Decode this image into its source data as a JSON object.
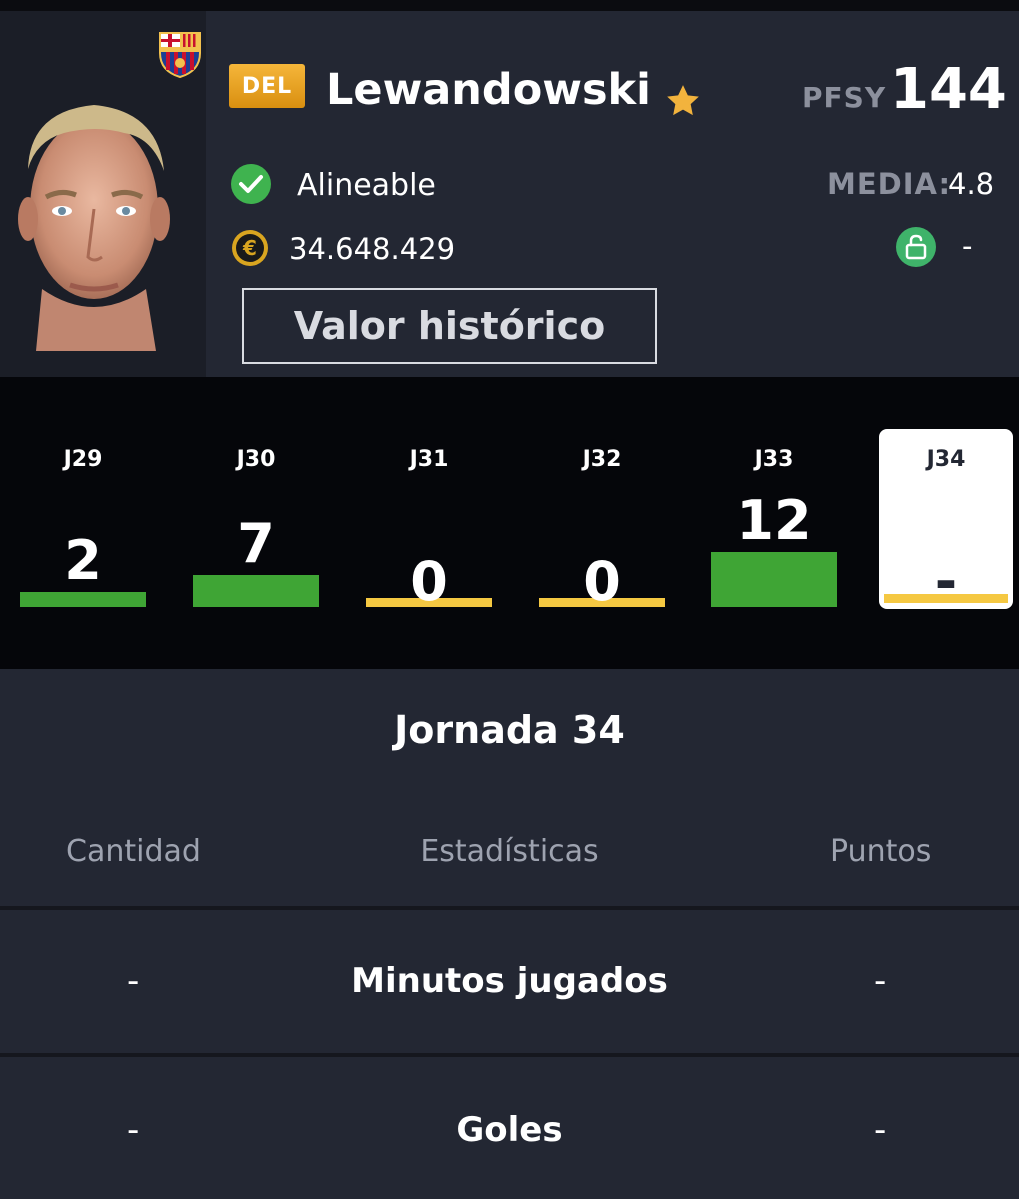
{
  "player": {
    "position": "DEL",
    "name": "Lewandowski",
    "pfsy_label": "PFSY",
    "pfsy_value": "144",
    "status": "Alineable",
    "media_label": "MEDIA:",
    "media_value": "4.8",
    "price": "34.648.429",
    "clause_value": "-",
    "history_button": "Valor histórico"
  },
  "colors": {
    "background": "#232733",
    "strip_background": "#05060a",
    "position_badge": "#f0a92b",
    "bar_positive": "#3fa535",
    "bar_zero": "#f5c842",
    "status_ok": "#3fb34f",
    "lock_green": "#3fb36a"
  },
  "matchdays": [
    {
      "label": "J29",
      "points": "2",
      "value": 2,
      "bar_color": "#3fa535",
      "selected": false
    },
    {
      "label": "J30",
      "points": "7",
      "value": 7,
      "bar_color": "#3fa535",
      "selected": false
    },
    {
      "label": "J31",
      "points": "0",
      "value": 0,
      "bar_color": "#f5c842",
      "selected": false
    },
    {
      "label": "J32",
      "points": "0",
      "value": 0,
      "bar_color": "#f5c842",
      "selected": false
    },
    {
      "label": "J33",
      "points": "12",
      "value": 12,
      "bar_color": "#3fa535",
      "selected": false
    },
    {
      "label": "J34",
      "points": "-",
      "value": 0,
      "bar_color": "#f5c842",
      "selected": true
    }
  ],
  "detail": {
    "title": "Jornada 34",
    "columns": [
      "Cantidad",
      "Estadísticas",
      "Puntos"
    ],
    "rows": [
      {
        "cantidad": "-",
        "stat": "Minutos jugados",
        "puntos": "-"
      },
      {
        "cantidad": "-",
        "stat": "Goles",
        "puntos": "-"
      }
    ]
  },
  "icons": {
    "club": "fc-barcelona-crest-icon",
    "favorite": "star-icon",
    "status": "check-circle-icon",
    "price": "euro-coin-icon",
    "clause": "unlock-icon"
  }
}
